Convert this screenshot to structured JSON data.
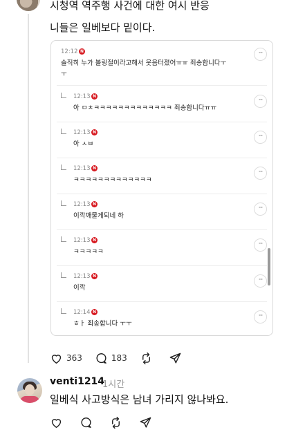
{
  "post": {
    "title": "시청역 역주행 사건에 대한 여시 반응",
    "body": "니들은 일베보다 밑이다."
  },
  "embedded_comments": [
    {
      "time": "12:12",
      "text": "솔직히 누가 볼링절이라고해서 웃음터졌어ㅠㅠ 죄송합니다ㅜ",
      "text2": "ㅜ",
      "reply": false
    },
    {
      "time": "12:13",
      "text": "아 ㅁㅊㅋㅋㅋㅋㅋㅋㅋㅋㅋㅋㅋㅋㅋ 죄송합니다ㅠㅠ",
      "reply": true
    },
    {
      "time": "12:13",
      "text": "아 ㅅㅂ",
      "reply": true
    },
    {
      "time": "12:13",
      "text": "ㅋㅋㅋㅋㅋㅋㅋㅋㅋㅋㅋㅋㅋ",
      "reply": true
    },
    {
      "time": "12:13",
      "text": "이깍깨물게되네 하",
      "reply": true
    },
    {
      "time": "12:13",
      "text": "ㅋㅋㅋㅋㅋ",
      "reply": true
    },
    {
      "time": "12:13",
      "text": "이깍",
      "reply": true
    },
    {
      "time": "12:14",
      "text": "ㅎㅏ 죄송합니다 ㅜㅜ",
      "reply": true
    }
  ],
  "badge_letter": "N",
  "more_glyph": "···",
  "post_actions": {
    "likes": "363",
    "comments": "183"
  },
  "reply": {
    "username": "venti1214",
    "ago": "1시간",
    "text": "일베식 사고방식은 남녀 가리지 않나봐요."
  },
  "colors": {
    "badge": "#d71920",
    "border": "#d9d9d9"
  }
}
